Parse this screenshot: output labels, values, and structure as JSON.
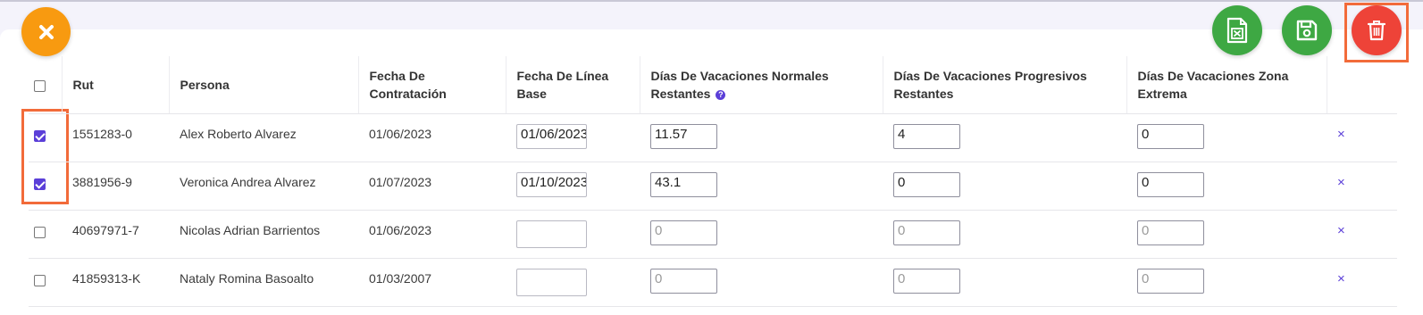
{
  "toolbar": {
    "close_icon": "close-icon",
    "excel_icon": "excel-file-icon",
    "save_icon": "floppy-disk-icon",
    "delete_icon": "trash-icon",
    "colors": {
      "close": "#f89a10",
      "excel": "#3ea843",
      "save": "#3ea843",
      "delete": "#ee4338",
      "highlight": "#f26b3a",
      "accent": "#5b3fd8"
    }
  },
  "table": {
    "headers": {
      "rut": "Rut",
      "persona": "Persona",
      "fecha_contratacion": "Fecha De Contratación",
      "fecha_linea_base": "Fecha De Línea Base",
      "dias_normales": "Días De Vacaciones Normales Restantes",
      "dias_progresivos": "Días De Vacaciones Progresivos Restantes",
      "dias_zona_extrema": "Días De Vacaciones Zona Extrema",
      "info_icon": "?"
    },
    "rows": [
      {
        "checked": true,
        "rut": "1551283-0",
        "persona": "Alex Roberto Alvarez",
        "fecha_contratacion": "01/06/2023",
        "fecha_linea_base": "01/06/2023",
        "normales": "11.57",
        "normales_placeholder": "",
        "progresivos": "4",
        "progresivos_placeholder": "",
        "zona_extrema": "0",
        "zona_placeholder": "",
        "delete": "×"
      },
      {
        "checked": true,
        "rut": "3881956-9",
        "persona": "Veronica Andrea Alvarez",
        "fecha_contratacion": "01/07/2023",
        "fecha_linea_base": "01/10/2023",
        "normales": "43.1",
        "normales_placeholder": "",
        "progresivos": "0",
        "progresivos_placeholder": "",
        "zona_extrema": "0",
        "zona_placeholder": "",
        "delete": "×"
      },
      {
        "checked": false,
        "rut": "40697971-7",
        "persona": "Nicolas Adrian Barrientos",
        "fecha_contratacion": "01/06/2023",
        "fecha_linea_base": "",
        "normales": "",
        "normales_placeholder": "0",
        "progresivos": "",
        "progresivos_placeholder": "0",
        "zona_extrema": "",
        "zona_placeholder": "0",
        "delete": "×"
      },
      {
        "checked": false,
        "rut": "41859313-K",
        "persona": "Nataly Romina Basoalto",
        "fecha_contratacion": "01/03/2007",
        "fecha_linea_base": "",
        "normales": "",
        "normales_placeholder": "0",
        "progresivos": "",
        "progresivos_placeholder": "0",
        "zona_extrema": "",
        "zona_placeholder": "0",
        "delete": "×"
      }
    ]
  }
}
